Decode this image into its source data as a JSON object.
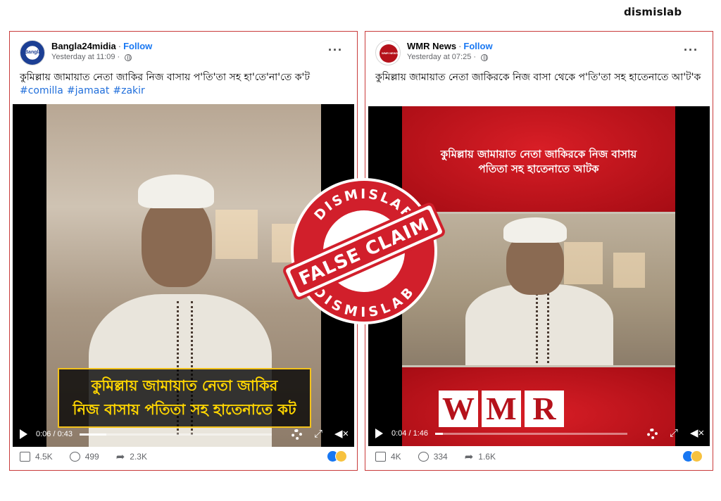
{
  "brand": {
    "name": "dismislab"
  },
  "posts": [
    {
      "page_name": "Bangla24midia",
      "follow_label": "Follow",
      "timestamp": "Yesterday at 11:09",
      "caption": "কুমিল্লায় জামায়াত নেতা জাকির নিজ বাসায় প'তি'তা সহ হা'তে'না'তে ক'ট",
      "hashtags": [
        "#comilla",
        "#jamaat",
        "#zakir"
      ],
      "video_subtitle_lines": [
        "কুমিল্লায় জামায়াত নেতা জাকির",
        "নিজ বাসায় পতিতা সহ হাতেনাতে কট"
      ],
      "video_time": "0:06 / 0:43",
      "progress_fraction": 0.14,
      "likes": "4.5K",
      "comments": "499",
      "shares": "2.3K",
      "avatar_text": "Bangla"
    },
    {
      "page_name": "WMR News",
      "follow_label": "Follow",
      "timestamp": "Yesterday at 07:25",
      "caption": "কুমিল্লায় জামায়াত নেতা জাকিরকে নিজ বাসা থেকে প'তি'তা সহ হাতেনাতে আ'ট'ক",
      "video_overlay_lines": [
        "কুমিল্লায় জামায়াত নেতা জাকিরকে নিজ বাসায়",
        "পতিতা সহ হাতেনাতে আটক"
      ],
      "video_logo_letters": [
        "W",
        "M",
        "R"
      ],
      "video_time": "0:04 / 1:46",
      "progress_fraction": 0.04,
      "likes": "4K",
      "comments": "334",
      "shares": "1.6K",
      "avatar_text": "WMR NEWS"
    }
  ],
  "stamp": {
    "top_text": "DISMISLAB",
    "center_text": "FALSE CLAIM",
    "bottom_text": "DISMISLAB",
    "color": "#d11f2b"
  },
  "icons": {
    "more": "more-options-icon",
    "privacy": "globe-icon",
    "play": "play-icon",
    "settings": "gear-icon",
    "fullscreen": "expand-icon",
    "volume": "mute-icon",
    "like": "like-icon",
    "comment": "comment-icon",
    "share": "share-icon"
  }
}
